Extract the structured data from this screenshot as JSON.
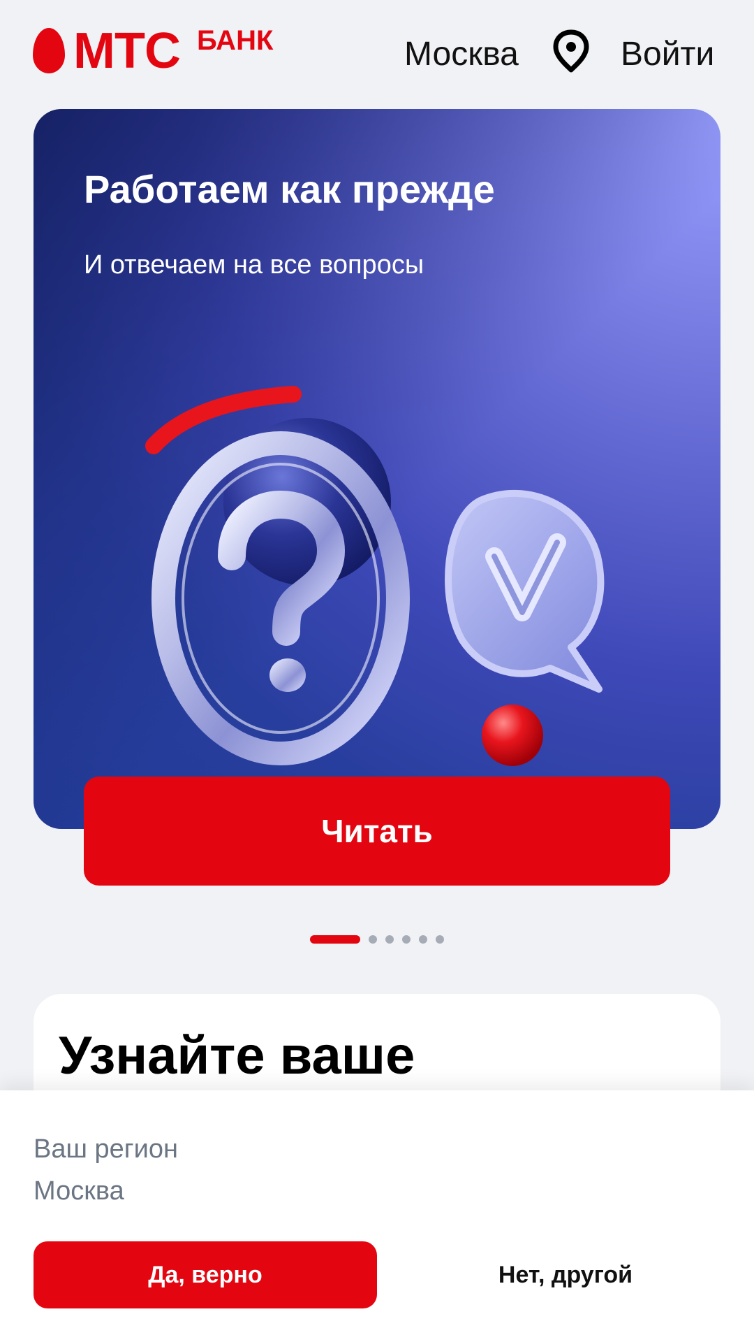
{
  "header": {
    "logo_mts": "МТС",
    "logo_bank": "БАНК",
    "city": "Москва",
    "pin_icon": "location-pin-icon",
    "login": "Войти"
  },
  "banner": {
    "title": "Работаем как прежде",
    "subtitle": "И отвечаем на все вопросы",
    "illustration_icons": [
      "question-mark-icon",
      "checkmark-chat-icon"
    ],
    "button": "Читать"
  },
  "carousel": {
    "total_slides": 6,
    "active_index": 0
  },
  "card": {
    "title": "Узнайте ваше"
  },
  "region_sheet": {
    "label": "Ваш регион",
    "value": "Москва",
    "confirm": "Да, верно",
    "reject": "Нет, другой"
  },
  "colors": {
    "brand_red": "#e30611",
    "background": "#f1f2f5",
    "muted_text": "#6b7583",
    "dot_inactive": "#a6acb5"
  }
}
